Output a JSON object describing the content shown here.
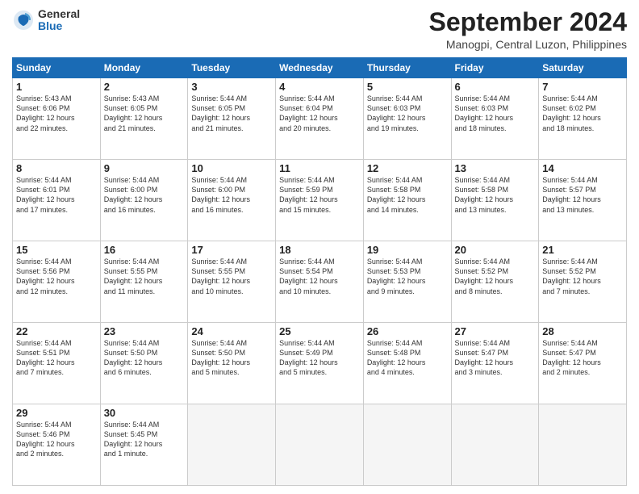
{
  "header": {
    "logo_general": "General",
    "logo_blue": "Blue",
    "title": "September 2024",
    "location": "Manogpi, Central Luzon, Philippines"
  },
  "weekdays": [
    "Sunday",
    "Monday",
    "Tuesday",
    "Wednesday",
    "Thursday",
    "Friday",
    "Saturday"
  ],
  "weeks": [
    [
      {
        "day": "1",
        "info": "Sunrise: 5:43 AM\nSunset: 6:06 PM\nDaylight: 12 hours\nand 22 minutes."
      },
      {
        "day": "2",
        "info": "Sunrise: 5:43 AM\nSunset: 6:05 PM\nDaylight: 12 hours\nand 21 minutes."
      },
      {
        "day": "3",
        "info": "Sunrise: 5:44 AM\nSunset: 6:05 PM\nDaylight: 12 hours\nand 21 minutes."
      },
      {
        "day": "4",
        "info": "Sunrise: 5:44 AM\nSunset: 6:04 PM\nDaylight: 12 hours\nand 20 minutes."
      },
      {
        "day": "5",
        "info": "Sunrise: 5:44 AM\nSunset: 6:03 PM\nDaylight: 12 hours\nand 19 minutes."
      },
      {
        "day": "6",
        "info": "Sunrise: 5:44 AM\nSunset: 6:03 PM\nDaylight: 12 hours\nand 18 minutes."
      },
      {
        "day": "7",
        "info": "Sunrise: 5:44 AM\nSunset: 6:02 PM\nDaylight: 12 hours\nand 18 minutes."
      }
    ],
    [
      {
        "day": "8",
        "info": "Sunrise: 5:44 AM\nSunset: 6:01 PM\nDaylight: 12 hours\nand 17 minutes."
      },
      {
        "day": "9",
        "info": "Sunrise: 5:44 AM\nSunset: 6:00 PM\nDaylight: 12 hours\nand 16 minutes."
      },
      {
        "day": "10",
        "info": "Sunrise: 5:44 AM\nSunset: 6:00 PM\nDaylight: 12 hours\nand 16 minutes."
      },
      {
        "day": "11",
        "info": "Sunrise: 5:44 AM\nSunset: 5:59 PM\nDaylight: 12 hours\nand 15 minutes."
      },
      {
        "day": "12",
        "info": "Sunrise: 5:44 AM\nSunset: 5:58 PM\nDaylight: 12 hours\nand 14 minutes."
      },
      {
        "day": "13",
        "info": "Sunrise: 5:44 AM\nSunset: 5:58 PM\nDaylight: 12 hours\nand 13 minutes."
      },
      {
        "day": "14",
        "info": "Sunrise: 5:44 AM\nSunset: 5:57 PM\nDaylight: 12 hours\nand 13 minutes."
      }
    ],
    [
      {
        "day": "15",
        "info": "Sunrise: 5:44 AM\nSunset: 5:56 PM\nDaylight: 12 hours\nand 12 minutes."
      },
      {
        "day": "16",
        "info": "Sunrise: 5:44 AM\nSunset: 5:55 PM\nDaylight: 12 hours\nand 11 minutes."
      },
      {
        "day": "17",
        "info": "Sunrise: 5:44 AM\nSunset: 5:55 PM\nDaylight: 12 hours\nand 10 minutes."
      },
      {
        "day": "18",
        "info": "Sunrise: 5:44 AM\nSunset: 5:54 PM\nDaylight: 12 hours\nand 10 minutes."
      },
      {
        "day": "19",
        "info": "Sunrise: 5:44 AM\nSunset: 5:53 PM\nDaylight: 12 hours\nand 9 minutes."
      },
      {
        "day": "20",
        "info": "Sunrise: 5:44 AM\nSunset: 5:52 PM\nDaylight: 12 hours\nand 8 minutes."
      },
      {
        "day": "21",
        "info": "Sunrise: 5:44 AM\nSunset: 5:52 PM\nDaylight: 12 hours\nand 7 minutes."
      }
    ],
    [
      {
        "day": "22",
        "info": "Sunrise: 5:44 AM\nSunset: 5:51 PM\nDaylight: 12 hours\nand 7 minutes."
      },
      {
        "day": "23",
        "info": "Sunrise: 5:44 AM\nSunset: 5:50 PM\nDaylight: 12 hours\nand 6 minutes."
      },
      {
        "day": "24",
        "info": "Sunrise: 5:44 AM\nSunset: 5:50 PM\nDaylight: 12 hours\nand 5 minutes."
      },
      {
        "day": "25",
        "info": "Sunrise: 5:44 AM\nSunset: 5:49 PM\nDaylight: 12 hours\nand 5 minutes."
      },
      {
        "day": "26",
        "info": "Sunrise: 5:44 AM\nSunset: 5:48 PM\nDaylight: 12 hours\nand 4 minutes."
      },
      {
        "day": "27",
        "info": "Sunrise: 5:44 AM\nSunset: 5:47 PM\nDaylight: 12 hours\nand 3 minutes."
      },
      {
        "day": "28",
        "info": "Sunrise: 5:44 AM\nSunset: 5:47 PM\nDaylight: 12 hours\nand 2 minutes."
      }
    ],
    [
      {
        "day": "29",
        "info": "Sunrise: 5:44 AM\nSunset: 5:46 PM\nDaylight: 12 hours\nand 2 minutes."
      },
      {
        "day": "30",
        "info": "Sunrise: 5:44 AM\nSunset: 5:45 PM\nDaylight: 12 hours\nand 1 minute."
      },
      {
        "day": "",
        "info": ""
      },
      {
        "day": "",
        "info": ""
      },
      {
        "day": "",
        "info": ""
      },
      {
        "day": "",
        "info": ""
      },
      {
        "day": "",
        "info": ""
      }
    ]
  ]
}
